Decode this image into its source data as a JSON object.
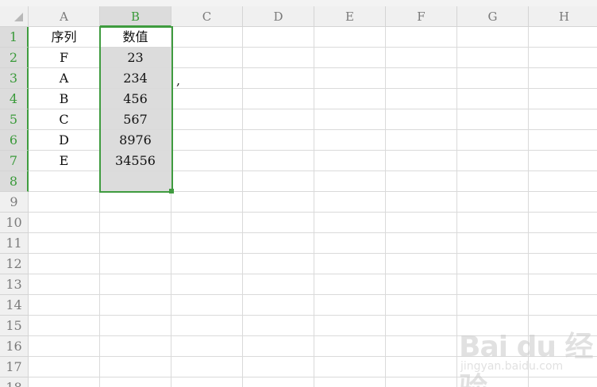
{
  "columns": [
    "A",
    "B",
    "C",
    "D",
    "E",
    "F",
    "G",
    "H"
  ],
  "selected_column": "B",
  "rows": [
    {
      "num": "1",
      "cells": [
        "序列",
        "数值",
        "",
        "",
        "",
        "",
        "",
        ""
      ]
    },
    {
      "num": "2",
      "cells": [
        "F",
        "23",
        "",
        "",
        "",
        "",
        "",
        ""
      ]
    },
    {
      "num": "3",
      "cells": [
        "A",
        "234",
        "",
        "",
        "",
        "",
        "",
        ""
      ]
    },
    {
      "num": "4",
      "cells": [
        "B",
        "456",
        "",
        "",
        "",
        "",
        "",
        ""
      ]
    },
    {
      "num": "5",
      "cells": [
        "C",
        "567",
        "",
        "",
        "",
        "",
        "",
        ""
      ]
    },
    {
      "num": "6",
      "cells": [
        "D",
        "8976",
        "",
        "",
        "",
        "",
        "",
        ""
      ]
    },
    {
      "num": "7",
      "cells": [
        "E",
        "34556",
        "",
        "",
        "",
        "",
        "",
        ""
      ]
    },
    {
      "num": "8",
      "cells": [
        "",
        "",
        "",
        "",
        "",
        "",
        "",
        ""
      ]
    },
    {
      "num": "9",
      "cells": [
        "",
        "",
        "",
        "",
        "",
        "",
        "",
        ""
      ]
    },
    {
      "num": "10",
      "cells": [
        "",
        "",
        "",
        "",
        "",
        "",
        "",
        ""
      ]
    },
    {
      "num": "11",
      "cells": [
        "",
        "",
        "",
        "",
        "",
        "",
        "",
        ""
      ]
    },
    {
      "num": "12",
      "cells": [
        "",
        "",
        "",
        "",
        "",
        "",
        "",
        ""
      ]
    },
    {
      "num": "13",
      "cells": [
        "",
        "",
        "",
        "",
        "",
        "",
        "",
        ""
      ]
    },
    {
      "num": "14",
      "cells": [
        "",
        "",
        "",
        "",
        "",
        "",
        "",
        ""
      ]
    },
    {
      "num": "15",
      "cells": [
        "",
        "",
        "",
        "",
        "",
        "",
        "",
        ""
      ]
    },
    {
      "num": "16",
      "cells": [
        "",
        "",
        "",
        "",
        "",
        "",
        "",
        ""
      ]
    },
    {
      "num": "17",
      "cells": [
        "",
        "",
        "",
        "",
        "",
        "",
        "",
        ""
      ]
    },
    {
      "num": "18",
      "cells": [
        "",
        "",
        "",
        "",
        "",
        "",
        "",
        ""
      ]
    }
  ],
  "selected_rows": [
    "1",
    "2",
    "3",
    "4",
    "5",
    "6",
    "7",
    "8"
  ],
  "stray_mark": ",",
  "watermark": {
    "main": "Bai du 经验",
    "sub": "jingyan.baidu.com"
  },
  "colors": {
    "selection": "#3f9b3f",
    "header_bg": "#f0f0f0",
    "selected_fill": "#dcdcdc"
  }
}
